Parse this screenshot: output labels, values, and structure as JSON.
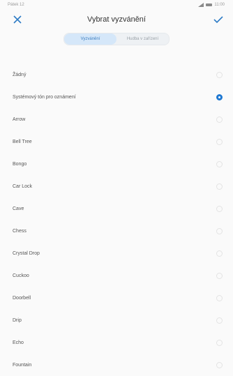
{
  "status_bar": {
    "time_text": "Pátek 12",
    "clock": "11:00"
  },
  "header": {
    "title": "Vybrat vyzvánění"
  },
  "tabs": [
    {
      "label": "Vyzvánění",
      "active": true
    },
    {
      "label": "Hudba v zařízení",
      "active": false
    }
  ],
  "ringtones": [
    {
      "label": "Žádný",
      "selected": false
    },
    {
      "label": "Systémový tón pro oznámení",
      "selected": true
    },
    {
      "label": "Arrow",
      "selected": false
    },
    {
      "label": "Bell Tree",
      "selected": false
    },
    {
      "label": "Bongo",
      "selected": false
    },
    {
      "label": "Car Lock",
      "selected": false
    },
    {
      "label": "Cave",
      "selected": false
    },
    {
      "label": "Chess",
      "selected": false
    },
    {
      "label": "Crystal Drop",
      "selected": false
    },
    {
      "label": "Cuckoo",
      "selected": false
    },
    {
      "label": "Doorbell",
      "selected": false
    },
    {
      "label": "Drip",
      "selected": false
    },
    {
      "label": "Echo",
      "selected": false
    },
    {
      "label": "Fountain",
      "selected": false
    }
  ],
  "colors": {
    "accent": "#1f78d1",
    "tab_active_bg": "#d5e7f9"
  }
}
